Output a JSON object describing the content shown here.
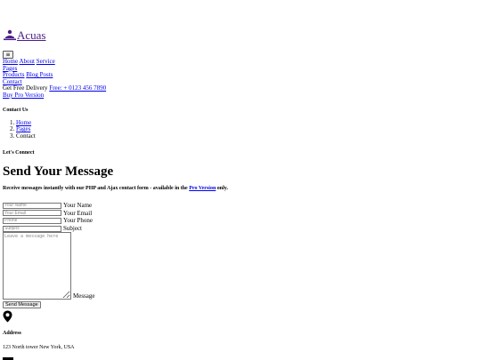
{
  "brand": {
    "name": "Acuas"
  },
  "nav": {
    "toggle_glyph": "≡",
    "items": [
      "Home",
      "About",
      "Service",
      "Pages",
      "Products",
      "Blog Posts",
      "Contact"
    ],
    "delivery_text": "Get Free Delivery",
    "delivery_link": "Free: + 0123 456 7890",
    "pro_link": "Buy Pro Version"
  },
  "header": {
    "title": "Contact Us",
    "breadcrumb": [
      "Home",
      "Pages",
      "Contact"
    ]
  },
  "section": {
    "eyebrow": "Let's Connect",
    "heading": "Send Your Message",
    "subtitle_before": "Receive messages instantly with our PHP and Ajax contact form - available in the ",
    "subtitle_link": "Pro Version",
    "subtitle_after": " only."
  },
  "form": {
    "fields": [
      {
        "placeholder": "Your Name",
        "label": "Your Name"
      },
      {
        "placeholder": "Your Email",
        "label": "Your Email"
      },
      {
        "placeholder": "Phone",
        "label": "Your Phone"
      },
      {
        "placeholder": "Subject",
        "label": "Subject"
      }
    ],
    "message_placeholder": "Leave a message here",
    "message_label": "Message",
    "submit_label": "Send Message"
  },
  "contact": {
    "address_title": "Address",
    "address_text": "123 North tower New York, USA"
  }
}
